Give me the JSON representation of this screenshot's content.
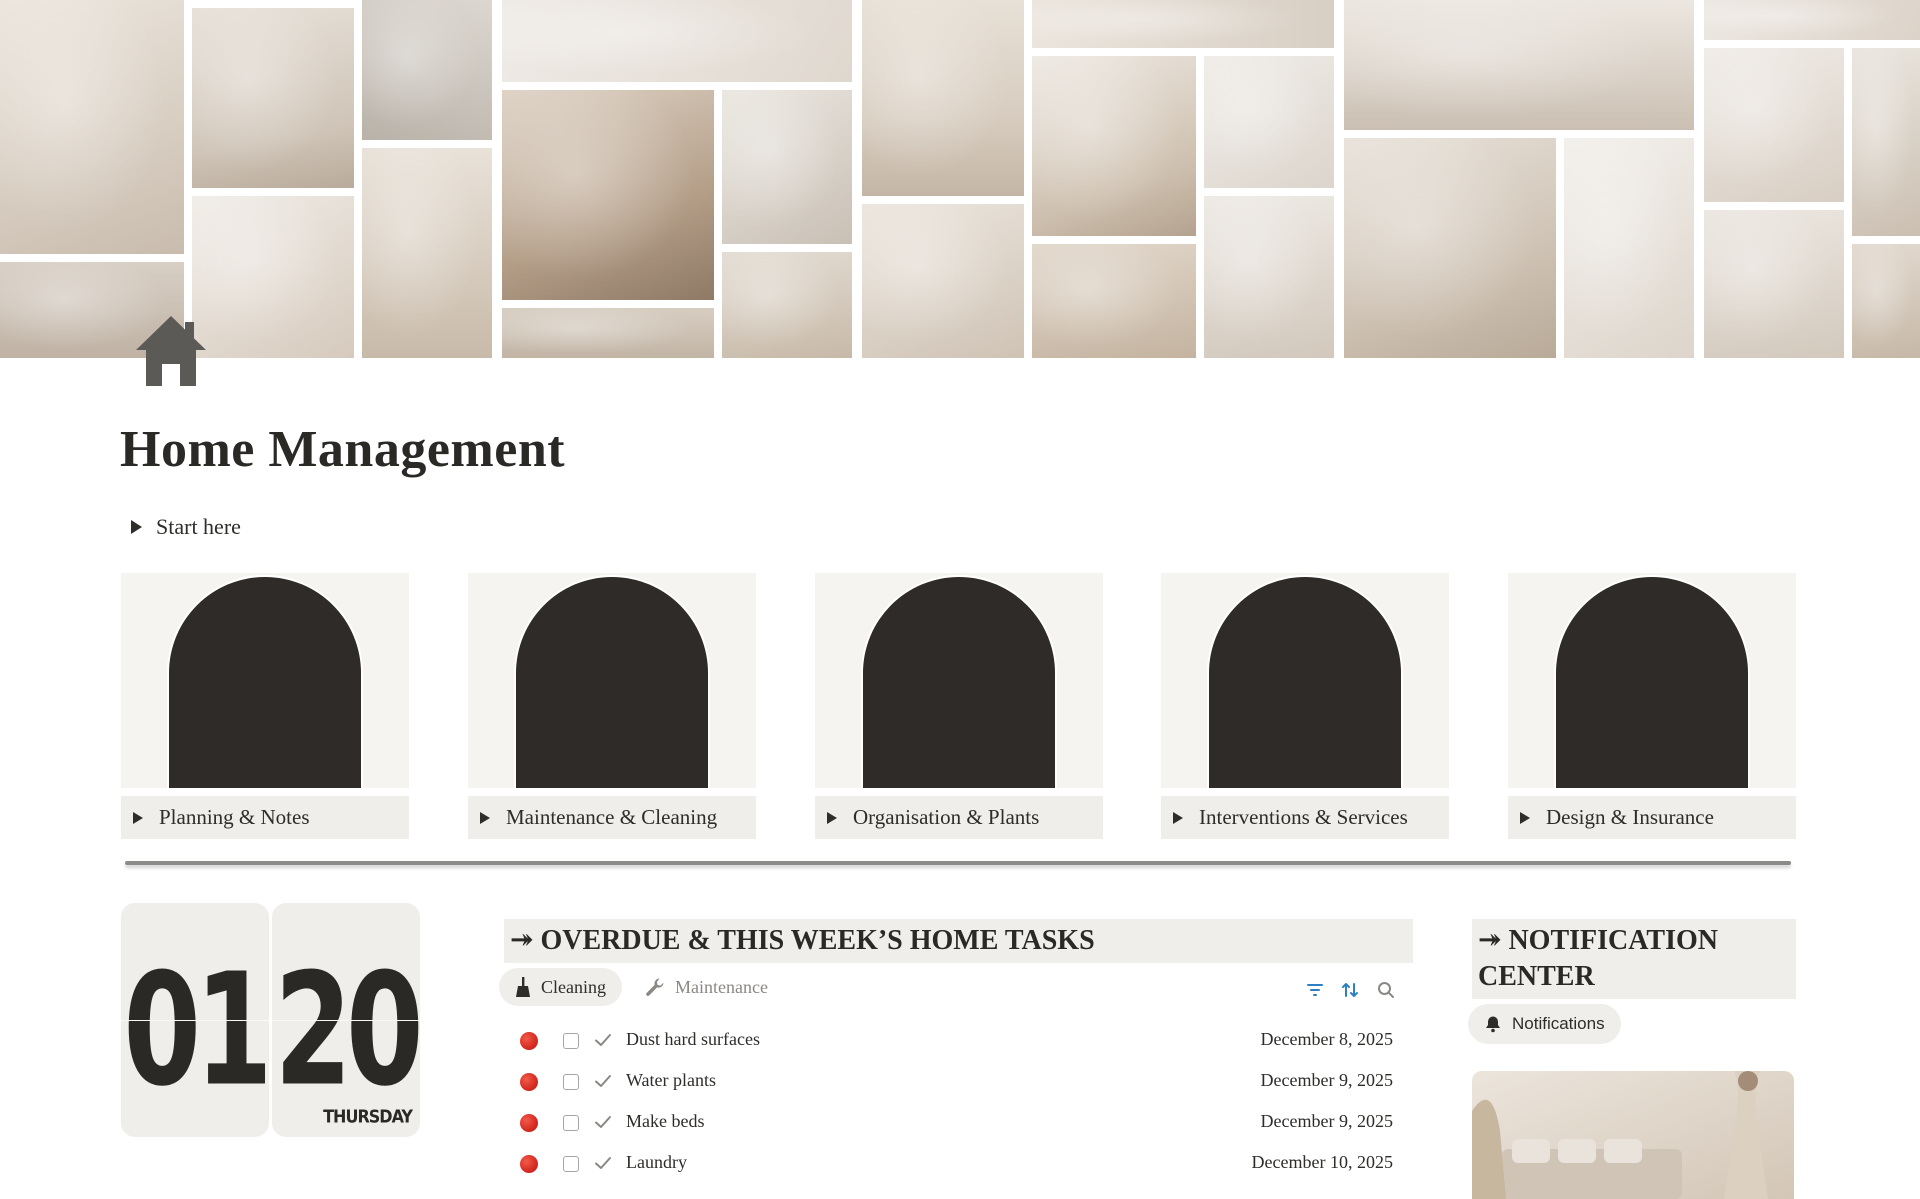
{
  "page": {
    "title": "Home Management",
    "icon": "house-icon"
  },
  "toggles": {
    "start_here": "Start here"
  },
  "categories": [
    {
      "label": "Planning & Notes"
    },
    {
      "label": "Maintenance & Cleaning"
    },
    {
      "label": "Organisation & Plants"
    },
    {
      "label": "Interventions & Services"
    },
    {
      "label": "Design & Insurance"
    }
  ],
  "clock": {
    "hour": "01",
    "minute": "20",
    "day": "THURSDAY"
  },
  "tasks_section": {
    "title": "↠ OVERDUE & THIS WEEK’S HOME TASKS",
    "tabs": [
      {
        "label": "Cleaning",
        "icon": "broom-icon",
        "active": true
      },
      {
        "label": "Maintenance",
        "icon": "wrench-icon",
        "active": false
      }
    ],
    "tools": [
      "filter-icon",
      "sort-icon",
      "search-icon"
    ],
    "rows": [
      {
        "name": "Dust hard surfaces",
        "date": "December 8, 2025",
        "status": "overdue"
      },
      {
        "name": "Water plants",
        "date": "December 9, 2025",
        "status": "overdue"
      },
      {
        "name": "Make beds",
        "date": "December 9, 2025",
        "status": "overdue"
      },
      {
        "name": "Laundry",
        "date": "December 10, 2025",
        "status": "overdue"
      }
    ]
  },
  "notification_section": {
    "title": "↠ NOTIFICATION CENTER",
    "tab_label": "Notifications",
    "tab_icon": "bell-icon"
  },
  "colors": {
    "accent_dark": "#2e2b28",
    "panel_bg": "#efeeeb",
    "card_bg": "#f6f4f1",
    "status_red": "#d52b22",
    "tool_blue": "#2e7fc4"
  }
}
